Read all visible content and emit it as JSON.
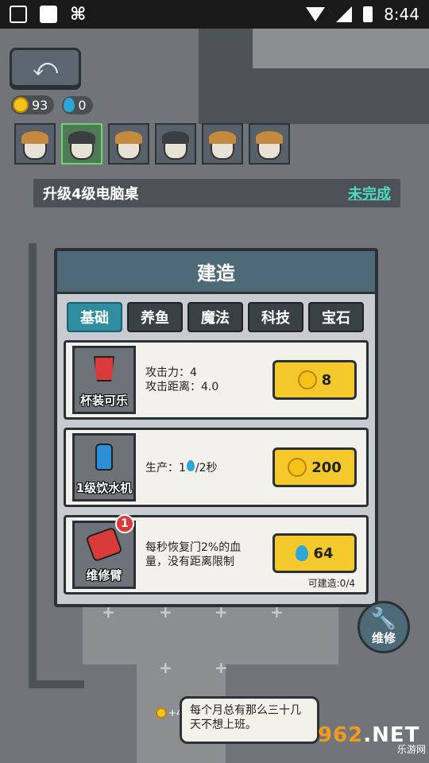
{
  "statusbar": {
    "time": "8:44"
  },
  "hud": {
    "back_icon": "return-arrow",
    "coins": "93",
    "water": "0"
  },
  "staff": [
    {
      "hair": "brown"
    },
    {
      "hair": "dark"
    },
    {
      "hair": "brown"
    },
    {
      "hair": "dark"
    },
    {
      "hair": "brown"
    },
    {
      "hair": "brown"
    }
  ],
  "task": {
    "text": "升级4级电脑桌",
    "status": "未完成"
  },
  "panel": {
    "title": "建造",
    "tabs": [
      "基础",
      "养鱼",
      "魔法",
      "科技",
      "宝石"
    ],
    "active_tab": "基础",
    "items": [
      {
        "name": "杯装可乐",
        "desc1": "攻击力：4",
        "desc2": "攻击距离：4.0",
        "price": "8",
        "currency": "coin"
      },
      {
        "name": "1级饮水机",
        "desc1": "生产：1",
        "desc2": "/2秒",
        "price": "200",
        "currency": "coin"
      },
      {
        "name": "维修臂",
        "desc1": "每秒恢复门2%的血",
        "desc2": "量，没有距离限制",
        "price": "64",
        "currency": "water",
        "badge": "1",
        "can_build": "可建造:0/4"
      }
    ]
  },
  "repair": {
    "label": "维修"
  },
  "speech": {
    "text": "每个月总有那么三十几天不想上班。"
  },
  "coin_gain": "+4",
  "watermark": {
    "top_a": "962",
    "top_b": ".NET",
    "bottom": "乐游网"
  }
}
